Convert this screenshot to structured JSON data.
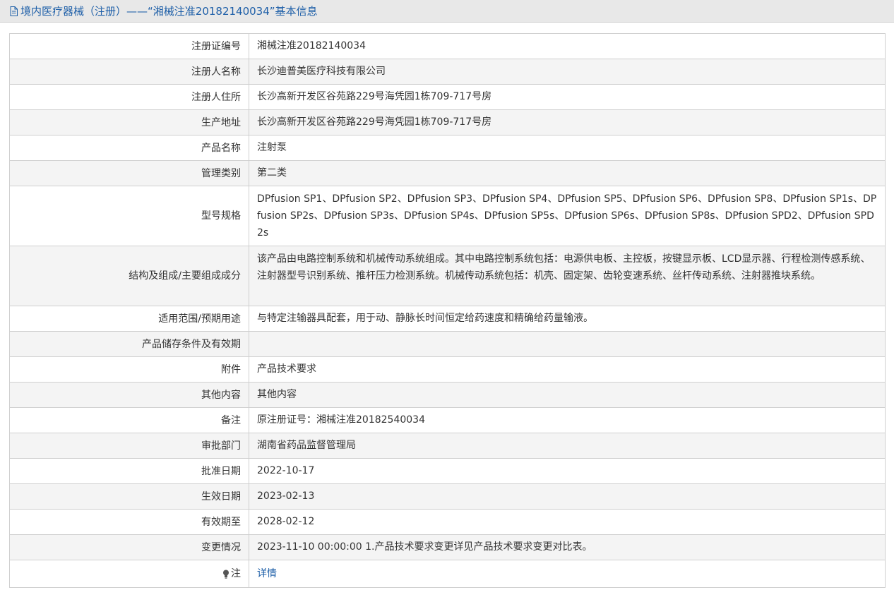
{
  "header": {
    "title": "境内医疗器械（注册）——“湘械注准20182140034”基本信息",
    "icon": "document-icon"
  },
  "rows": [
    {
      "label": "注册证编号",
      "value": "湘械注准20182140034"
    },
    {
      "label": "注册人名称",
      "value": "长沙迪普美医疗科技有限公司"
    },
    {
      "label": "注册人住所",
      "value": "长沙高新开发区谷苑路229号海凭园1栋709-717号房"
    },
    {
      "label": "生产地址",
      "value": "长沙高新开发区谷苑路229号海凭园1栋709-717号房"
    },
    {
      "label": "产品名称",
      "value": "注射泵"
    },
    {
      "label": "管理类别",
      "value": "第二类"
    },
    {
      "label": "型号规格",
      "value": "DPfusion SP1、DPfusion SP2、DPfusion SP3、DPfusion SP4、DPfusion SP5、DPfusion SP6、DPfusion SP8、DPfusion SP1s、DPfusion SP2s、DPfusion SP3s、DPfusion SP4s、DPfusion SP5s、DPfusion SP6s、DPfusion SP8s、DPfusion SPD2、DPfusion SPD2s"
    },
    {
      "label": "结构及组成/主要组成成分",
      "value": "该产品由电路控制系统和机械传动系统组成。其中电路控制系统包括：电源供电板、主控板，按键显示板、LCD显示器、行程检测传感系统、注射器型号识别系统、推杆压力检测系统。机械传动系统包括：机壳、固定架、齿轮变速系统、丝杆传动系统、注射器推块系统。"
    },
    {
      "label": "适用范围/预期用途",
      "value": "与特定注输器具配套，用于动、静脉长时间恒定给药速度和精确给药量输液。"
    },
    {
      "label": "产品储存条件及有效期",
      "value": ""
    },
    {
      "label": "附件",
      "value": "产品技术要求"
    },
    {
      "label": "其他内容",
      "value": "其他内容"
    },
    {
      "label": "备注",
      "value": "原注册证号：湘械注准20182540034"
    },
    {
      "label": "审批部门",
      "value": "湖南省药品监督管理局"
    },
    {
      "label": "批准日期",
      "value": "2022-10-17"
    },
    {
      "label": "生效日期",
      "value": "2023-02-13"
    },
    {
      "label": "有效期至",
      "value": "2028-02-12"
    },
    {
      "label": "变更情况",
      "value": "2023-11-10 00:00:00 1.产品技术要求变更详见产品技术要求变更对比表。"
    }
  ],
  "note_row": {
    "label": "注",
    "link": "详情",
    "icon": "lightbulb-icon"
  },
  "colors": {
    "link": "#1e5fa8",
    "border": "#cfcfcf",
    "alt_row": "#f4f4f4",
    "header_bg": "#e8e8e8"
  }
}
